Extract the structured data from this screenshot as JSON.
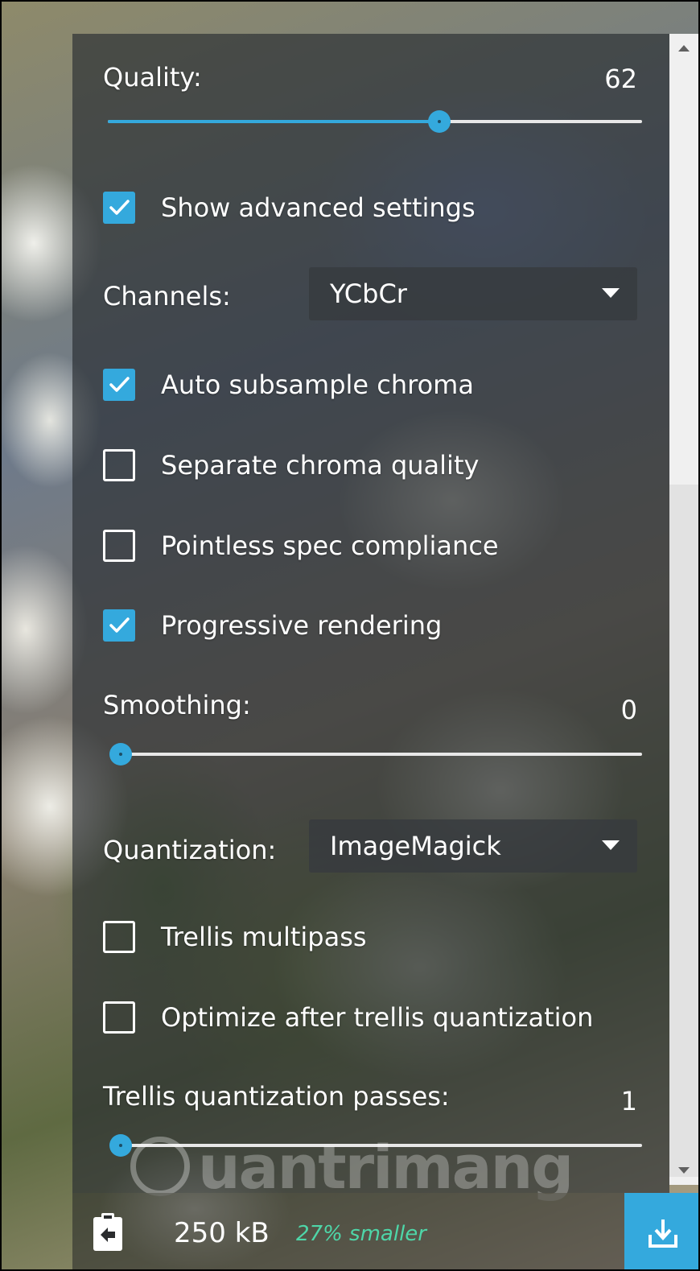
{
  "quality": {
    "label": "Quality:",
    "value": "62",
    "fraction": 0.62
  },
  "show_advanced": {
    "label": "Show advanced settings",
    "checked": true
  },
  "channels": {
    "label": "Channels:",
    "selected": "YCbCr"
  },
  "options": [
    {
      "label": "Auto subsample chroma",
      "checked": true
    },
    {
      "label": "Separate chroma quality",
      "checked": false
    },
    {
      "label": "Pointless spec compliance",
      "checked": false
    },
    {
      "label": "Progressive rendering",
      "checked": true
    }
  ],
  "smoothing": {
    "label": "Smoothing:",
    "value": "0",
    "fraction": 0
  },
  "quantization": {
    "label": "Quantization:",
    "selected": "ImageMagick"
  },
  "trellis_options": [
    {
      "label": "Trellis multipass",
      "checked": false
    },
    {
      "label": "Optimize after trellis quantization",
      "checked": false
    }
  ],
  "trellis_passes": {
    "label": "Trellis quantization passes:",
    "value": "1",
    "fraction": 0
  },
  "footer": {
    "size": "250 kB",
    "savings": "27% smaller"
  },
  "watermark": "uantrimang",
  "colors": {
    "accent": "#34a9dd",
    "savings": "#4ed6a8"
  }
}
